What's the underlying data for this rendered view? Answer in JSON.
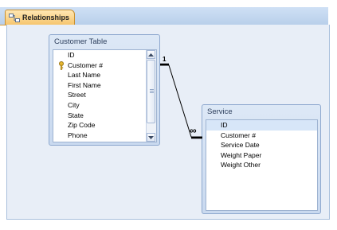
{
  "tab": {
    "label": "Relationships",
    "icon": "relationships-icon"
  },
  "customer_table": {
    "title": "Customer Table",
    "fields": [
      {
        "label": "ID",
        "key": false
      },
      {
        "label": "Customer #",
        "key": true
      },
      {
        "label": "Last Name",
        "key": false
      },
      {
        "label": "First Name",
        "key": false
      },
      {
        "label": "Street",
        "key": false
      },
      {
        "label": "City",
        "key": false
      },
      {
        "label": "State",
        "key": false
      },
      {
        "label": "Zip Code",
        "key": false
      },
      {
        "label": "Phone",
        "key": false
      }
    ]
  },
  "service_table": {
    "title": "Service",
    "fields": [
      {
        "label": "ID"
      },
      {
        "label": "Customer #"
      },
      {
        "label": "Service Date"
      },
      {
        "label": "Weight Paper"
      },
      {
        "label": "Weight Other"
      }
    ]
  },
  "relationship": {
    "one_label": "1",
    "many_label": "∞"
  },
  "colors": {
    "tab_accent": "#f6c56e",
    "canvas": "#e8eef7",
    "selected_row": "#d7e6f8"
  }
}
